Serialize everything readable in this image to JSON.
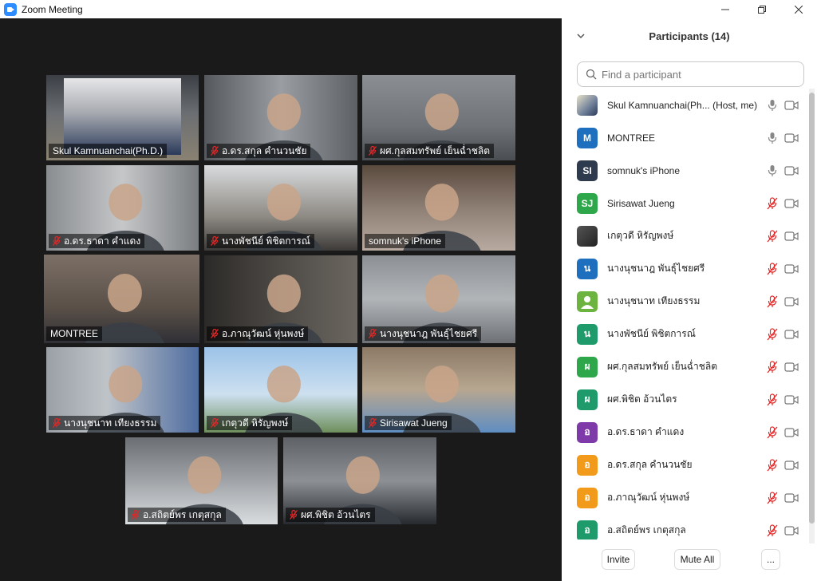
{
  "window": {
    "title": "Zoom Meeting"
  },
  "tiles": [
    {
      "name": "Skul Kamnuanchai(Ph.D.)",
      "muted": false,
      "active": false
    },
    {
      "name": "อ.ดร.สกุล  คำนวนชัย",
      "muted": true,
      "active": false
    },
    {
      "name": "ผศ.กุลสมทรัพย์  เย็นฉ่ำชลิต",
      "muted": true,
      "active": false
    },
    {
      "name": "อ.ดร.ธาดา  คำแดง",
      "muted": true,
      "active": false
    },
    {
      "name": "นางพัชนีย์  พิชิตการณ์",
      "muted": true,
      "active": false
    },
    {
      "name": "somnuk's iPhone",
      "muted": false,
      "active": false
    },
    {
      "name": "MONTREE",
      "muted": false,
      "active": true
    },
    {
      "name": "อ.ภาณุวัฒน์  หุ่นพงษ์",
      "muted": true,
      "active": false
    },
    {
      "name": "นางนุชนาฎ  พันธุ์ไชยศรี",
      "muted": true,
      "active": false
    },
    {
      "name": "นางนุชนาท  เทียงธรรม",
      "muted": true,
      "active": false
    },
    {
      "name": "เกตุวดี  หิรัญพงษ์",
      "muted": true,
      "active": false
    },
    {
      "name": "Sirisawat Jueng",
      "muted": true,
      "active": false
    },
    {
      "name": "อ.สถิตย์พร  เกตุสกุล",
      "muted": true,
      "active": false
    },
    {
      "name": "ผศ.พิชิต  อ้วนไตร",
      "muted": true,
      "active": false
    }
  ],
  "panel": {
    "title": "Participants (14)",
    "search_placeholder": "Find a participant",
    "participants": [
      {
        "name": "Skul Kamnuanchai(Ph... (Host, me)",
        "initials": "",
        "color": "#ffffff",
        "photo": true,
        "muted": false
      },
      {
        "name": "MONTREE",
        "initials": "M",
        "color": "#1f6fbf",
        "photo": false,
        "muted": false
      },
      {
        "name": "somnuk's iPhone",
        "initials": "SI",
        "color": "#2e3a4d",
        "photo": false,
        "muted": false
      },
      {
        "name": "Sirisawat Jueng",
        "initials": "SJ",
        "color": "#2ea64a",
        "photo": false,
        "muted": true
      },
      {
        "name": "เกตุวดี หิรัญพงษ์",
        "initials": "",
        "color": "#333333",
        "photo": true,
        "muted": true
      },
      {
        "name": "นางนุชนาฎ  พันธุ์ไชยศรี",
        "initials": "น",
        "color": "#1f6fbf",
        "photo": false,
        "muted": true
      },
      {
        "name": "นางนุชนาท  เทียงธรรม",
        "initials": "",
        "color": "#6cb43f",
        "photo": false,
        "muted": true
      },
      {
        "name": "นางพัชนีย์  พิชิตการณ์",
        "initials": "น",
        "color": "#1f9a6a",
        "photo": false,
        "muted": true
      },
      {
        "name": "ผศ.กุลสมทรัพย์  เย็นฉ่ำชลิต",
        "initials": "ผ",
        "color": "#2ea64a",
        "photo": false,
        "muted": true
      },
      {
        "name": "ผศ.พิชิต  อ้วนไตร",
        "initials": "ผ",
        "color": "#1f9a6a",
        "photo": false,
        "muted": true
      },
      {
        "name": "อ.ดร.ธาดา  คำแดง",
        "initials": "อ",
        "color": "#7e3aa8",
        "photo": false,
        "muted": true
      },
      {
        "name": "อ.ดร.สกุล  คำนวนชัย",
        "initials": "อ",
        "color": "#f29a1a",
        "photo": false,
        "muted": true
      },
      {
        "name": "อ.ภาณุวัฒน์  หุ่นพงษ์",
        "initials": "อ",
        "color": "#f29a1a",
        "photo": false,
        "muted": true
      },
      {
        "name": "อ.สถิตย์พร  เกตุสกุล",
        "initials": "อ",
        "color": "#1f9a6a",
        "photo": false,
        "muted": true
      }
    ],
    "invite_label": "Invite",
    "mute_all_label": "Mute All",
    "more_label": "..."
  }
}
